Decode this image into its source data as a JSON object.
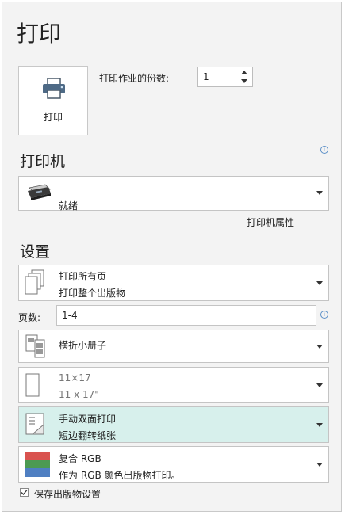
{
  "page": {
    "title": "打印"
  },
  "print_button": {
    "label": "打印"
  },
  "copies": {
    "label": "打印作业的份数:",
    "value": "1"
  },
  "printer": {
    "section_title": "打印机",
    "status": "就绪",
    "properties_link": "打印机属性"
  },
  "settings": {
    "section_title": "设置",
    "print_range": {
      "line1": "打印所有页",
      "line2": "打印整个出版物"
    },
    "pages": {
      "label": "页数:",
      "value": "1-4"
    },
    "layout": {
      "line1": "横折小册子"
    },
    "paper_size": {
      "line1": "11×17",
      "line2": "11 x 17\""
    },
    "duplex": {
      "line1": "手动双面打印",
      "line2": "短边翻转纸张",
      "highlight_color": "#d7f0ec"
    },
    "color": {
      "line1": "复合 RGB",
      "line2": "作为 RGB 颜色出版物打印。"
    },
    "save_settings": {
      "label": "保存出版物设置",
      "checked": true
    }
  },
  "icons": {
    "printer": "printer-icon",
    "info": "info-icon",
    "pages": "pages-icon",
    "booklet": "booklet-icon",
    "paper": "paper-icon",
    "duplex": "duplex-icon",
    "color": "color-swatch-icon",
    "check": "checkmark-icon"
  }
}
